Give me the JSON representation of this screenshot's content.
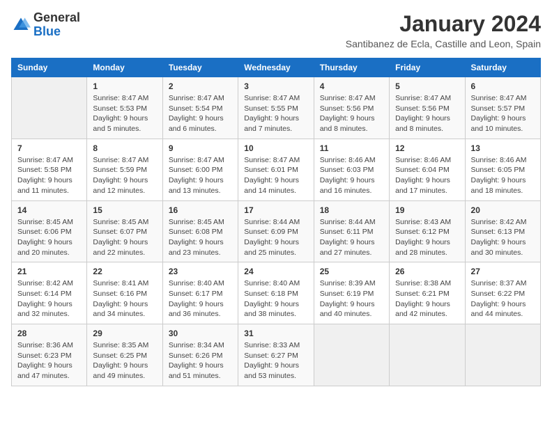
{
  "header": {
    "logo_general": "General",
    "logo_blue": "Blue",
    "month_title": "January 2024",
    "location": "Santibanez de Ecla, Castille and Leon, Spain"
  },
  "weekdays": [
    "Sunday",
    "Monday",
    "Tuesday",
    "Wednesday",
    "Thursday",
    "Friday",
    "Saturday"
  ],
  "weeks": [
    [
      {
        "day": "",
        "info": ""
      },
      {
        "day": "1",
        "info": "Sunrise: 8:47 AM\nSunset: 5:53 PM\nDaylight: 9 hours\nand 5 minutes."
      },
      {
        "day": "2",
        "info": "Sunrise: 8:47 AM\nSunset: 5:54 PM\nDaylight: 9 hours\nand 6 minutes."
      },
      {
        "day": "3",
        "info": "Sunrise: 8:47 AM\nSunset: 5:55 PM\nDaylight: 9 hours\nand 7 minutes."
      },
      {
        "day": "4",
        "info": "Sunrise: 8:47 AM\nSunset: 5:56 PM\nDaylight: 9 hours\nand 8 minutes."
      },
      {
        "day": "5",
        "info": "Sunrise: 8:47 AM\nSunset: 5:56 PM\nDaylight: 9 hours\nand 8 minutes."
      },
      {
        "day": "6",
        "info": "Sunrise: 8:47 AM\nSunset: 5:57 PM\nDaylight: 9 hours\nand 10 minutes."
      }
    ],
    [
      {
        "day": "7",
        "info": "Sunrise: 8:47 AM\nSunset: 5:58 PM\nDaylight: 9 hours\nand 11 minutes."
      },
      {
        "day": "8",
        "info": "Sunrise: 8:47 AM\nSunset: 5:59 PM\nDaylight: 9 hours\nand 12 minutes."
      },
      {
        "day": "9",
        "info": "Sunrise: 8:47 AM\nSunset: 6:00 PM\nDaylight: 9 hours\nand 13 minutes."
      },
      {
        "day": "10",
        "info": "Sunrise: 8:47 AM\nSunset: 6:01 PM\nDaylight: 9 hours\nand 14 minutes."
      },
      {
        "day": "11",
        "info": "Sunrise: 8:46 AM\nSunset: 6:03 PM\nDaylight: 9 hours\nand 16 minutes."
      },
      {
        "day": "12",
        "info": "Sunrise: 8:46 AM\nSunset: 6:04 PM\nDaylight: 9 hours\nand 17 minutes."
      },
      {
        "day": "13",
        "info": "Sunrise: 8:46 AM\nSunset: 6:05 PM\nDaylight: 9 hours\nand 18 minutes."
      }
    ],
    [
      {
        "day": "14",
        "info": "Sunrise: 8:45 AM\nSunset: 6:06 PM\nDaylight: 9 hours\nand 20 minutes."
      },
      {
        "day": "15",
        "info": "Sunrise: 8:45 AM\nSunset: 6:07 PM\nDaylight: 9 hours\nand 22 minutes."
      },
      {
        "day": "16",
        "info": "Sunrise: 8:45 AM\nSunset: 6:08 PM\nDaylight: 9 hours\nand 23 minutes."
      },
      {
        "day": "17",
        "info": "Sunrise: 8:44 AM\nSunset: 6:09 PM\nDaylight: 9 hours\nand 25 minutes."
      },
      {
        "day": "18",
        "info": "Sunrise: 8:44 AM\nSunset: 6:11 PM\nDaylight: 9 hours\nand 27 minutes."
      },
      {
        "day": "19",
        "info": "Sunrise: 8:43 AM\nSunset: 6:12 PM\nDaylight: 9 hours\nand 28 minutes."
      },
      {
        "day": "20",
        "info": "Sunrise: 8:42 AM\nSunset: 6:13 PM\nDaylight: 9 hours\nand 30 minutes."
      }
    ],
    [
      {
        "day": "21",
        "info": "Sunrise: 8:42 AM\nSunset: 6:14 PM\nDaylight: 9 hours\nand 32 minutes."
      },
      {
        "day": "22",
        "info": "Sunrise: 8:41 AM\nSunset: 6:16 PM\nDaylight: 9 hours\nand 34 minutes."
      },
      {
        "day": "23",
        "info": "Sunrise: 8:40 AM\nSunset: 6:17 PM\nDaylight: 9 hours\nand 36 minutes."
      },
      {
        "day": "24",
        "info": "Sunrise: 8:40 AM\nSunset: 6:18 PM\nDaylight: 9 hours\nand 38 minutes."
      },
      {
        "day": "25",
        "info": "Sunrise: 8:39 AM\nSunset: 6:19 PM\nDaylight: 9 hours\nand 40 minutes."
      },
      {
        "day": "26",
        "info": "Sunrise: 8:38 AM\nSunset: 6:21 PM\nDaylight: 9 hours\nand 42 minutes."
      },
      {
        "day": "27",
        "info": "Sunrise: 8:37 AM\nSunset: 6:22 PM\nDaylight: 9 hours\nand 44 minutes."
      }
    ],
    [
      {
        "day": "28",
        "info": "Sunrise: 8:36 AM\nSunset: 6:23 PM\nDaylight: 9 hours\nand 47 minutes."
      },
      {
        "day": "29",
        "info": "Sunrise: 8:35 AM\nSunset: 6:25 PM\nDaylight: 9 hours\nand 49 minutes."
      },
      {
        "day": "30",
        "info": "Sunrise: 8:34 AM\nSunset: 6:26 PM\nDaylight: 9 hours\nand 51 minutes."
      },
      {
        "day": "31",
        "info": "Sunrise: 8:33 AM\nSunset: 6:27 PM\nDaylight: 9 hours\nand 53 minutes."
      },
      {
        "day": "",
        "info": ""
      },
      {
        "day": "",
        "info": ""
      },
      {
        "day": "",
        "info": ""
      }
    ]
  ]
}
